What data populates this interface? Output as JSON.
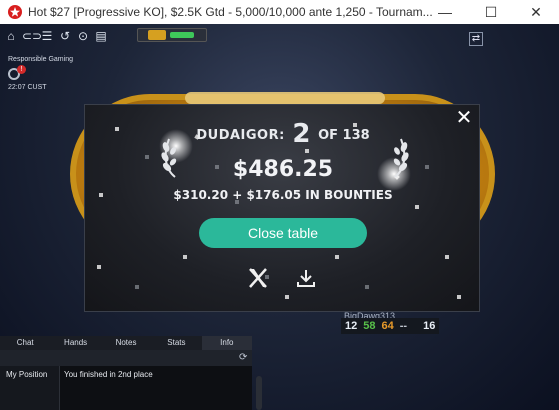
{
  "window": {
    "title": "Hot $27 [Progressive KO], $2.5K Gtd - 5,000/10,000 ante 1,250 - Tournam...",
    "minimize": "—",
    "maximize": "☐",
    "close": "✕"
  },
  "sidebar": {
    "responsible_gaming": "Responsible Gaming",
    "badge": "!",
    "time": "22:07 CUST"
  },
  "modal": {
    "player": "DUDAIGOR:",
    "place": "2",
    "of": "OF 138",
    "prize": "$486.25",
    "bounties": "$310.20 + $176.05 IN BOUNTIES",
    "close_table": "Close table",
    "close_x": "✕"
  },
  "player_box": {
    "name": "BigDawg313",
    "stat1": "12",
    "stat2": "58",
    "stat3": "64",
    "stat4": "--",
    "stat5": "16"
  },
  "tabs": [
    "Chat",
    "Hands",
    "Notes",
    "Stats",
    "Info"
  ],
  "info": {
    "key": "My Position",
    "value": "You finished in 2nd place"
  },
  "colors": {
    "accent": "#2bb89a",
    "felt": "#e0a018",
    "stat_green": "#58c04a",
    "stat_orange": "#e89a2a"
  }
}
